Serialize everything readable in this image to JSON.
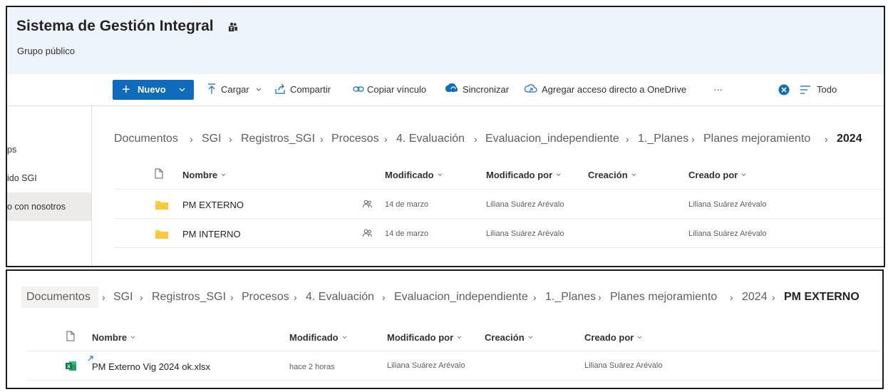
{
  "site": {
    "title": "Sistema de Gestión Integral",
    "subtitle": "Grupo público"
  },
  "nav": {
    "items": [
      {
        "label": "ps"
      },
      {
        "label": "ido SGI"
      },
      {
        "label": "o con nosotros"
      }
    ]
  },
  "commandbar": {
    "new_label": "Nuevo",
    "upload_label": "Cargar",
    "share_label": "Compartir",
    "copy_link_label": "Copiar vínculo",
    "sync_label": "Sincronizar",
    "shortcut_label": "Agregar acceso directo a OneDrive",
    "more_label": "···",
    "view_label": "Todo"
  },
  "breadcrumb1": [
    "Documentos",
    "SGI",
    "Registros_SGI",
    "Procesos",
    "4. Evaluación",
    "Evaluacion_independiente",
    "1._Planes",
    "Planes mejoramiento",
    "2024"
  ],
  "breadcrumb2": [
    "Documentos",
    "SGI",
    "Registros_SGI",
    "Procesos",
    "4. Evaluación",
    "Evaluacion_independiente",
    "1._Planes",
    "Planes mejoramiento",
    "2024",
    "PM EXTERNO"
  ],
  "columns": {
    "name": "Nombre",
    "modified": "Modificado",
    "modified_by": "Modificado por",
    "created": "Creación",
    "created_by": "Creado por"
  },
  "list1": [
    {
      "name": "PM EXTERNO",
      "modified": "14 de marzo",
      "modified_by": "Liliana Suárez Arévalo",
      "created": "",
      "created_by": "Liliana Suárez Arévalo"
    },
    {
      "name": "PM INTERNO",
      "modified": "14 de marzo",
      "modified_by": "Liliana Suárez Arévalo",
      "created": "",
      "created_by": "Liliana Suárez Arévalo"
    }
  ],
  "list2": [
    {
      "name": "PM Externo Vig 2024 ok.xlsx",
      "modified": "hace 2 horas",
      "modified_by": "Liliana Suárez Arévalo",
      "created": "",
      "created_by": "Liliana Suárez Arévalo"
    }
  ],
  "colors": {
    "accent": "#0f6cbd",
    "folder": "#f8d33a",
    "excel": "#107c41",
    "header_bg": "#eef4fc"
  },
  "icons": {
    "site": "teams-icon",
    "folder": "folder-icon",
    "shared": "shared-people-icon",
    "file": "excel-icon"
  }
}
